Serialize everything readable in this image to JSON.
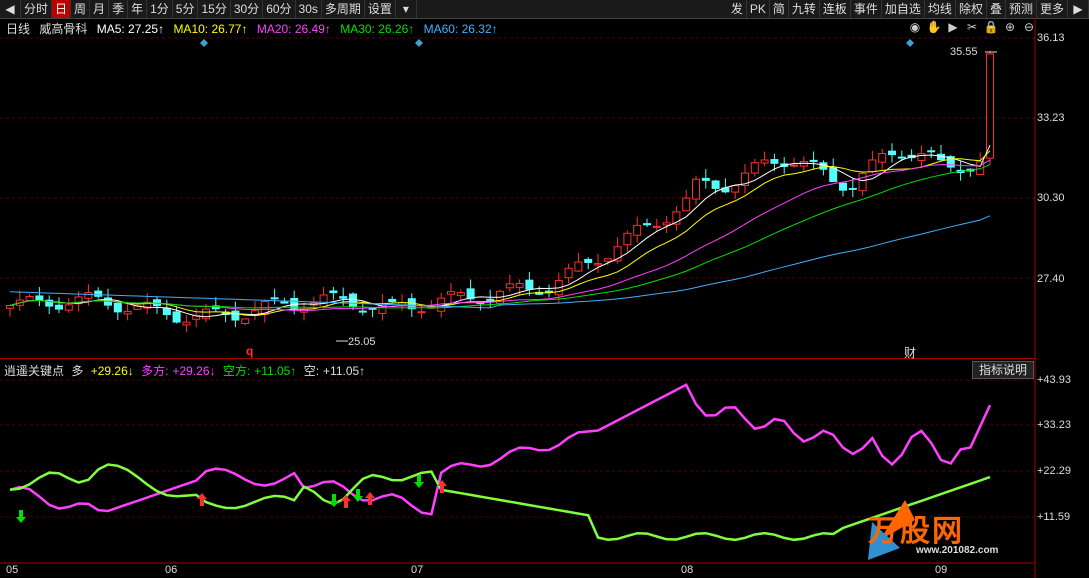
{
  "toolbar": {
    "left": [
      "分时",
      "日",
      "周",
      "月",
      "季",
      "年",
      "1分",
      "5分",
      "15分",
      "30分",
      "60分",
      "30s",
      "多周期",
      "设置"
    ],
    "active_index": 1,
    "right": [
      "发",
      "PK",
      "简",
      "九转",
      "连板",
      "事件",
      "加自选",
      "均线",
      "除权",
      "叠",
      "预测",
      "更多"
    ]
  },
  "legend": {
    "period": "日线",
    "name": "威高骨科",
    "ma5": "MA5: 27.25↑",
    "ma10": "MA10: 26.77↑",
    "ma20": "MA20: 26.49↑",
    "ma30": "MA30: 26.26↑",
    "ma60": "MA60: 26.32↑"
  },
  "colors": {
    "ma5": "#ffffff",
    "ma10": "#ffff00",
    "ma20": "#ff40ff",
    "ma30": "#00e000",
    "ma60": "#40b0ff",
    "up": "#ff3030",
    "down": "#54fcfc"
  },
  "price_axis": [
    "36.13",
    "33.23",
    "30.30",
    "27.40"
  ],
  "indicator_axis": [
    "+43.93",
    "+33.23",
    "+22.29",
    "+11.59"
  ],
  "dates": [
    "05",
    "06",
    "07",
    "08",
    "09"
  ],
  "annotations": {
    "high": "35.55",
    "low": "25.05",
    "mark_q": "q",
    "mark_cai": "财"
  },
  "indicator": {
    "name": "逍遥关键点",
    "duo": "多",
    "v1": "+29.26↓",
    "duofang_label": "多方:",
    "duofang": "+29.26↓",
    "kongfang_label": "空方:",
    "kongfang": "+11.05↑",
    "kong_label": "空:",
    "kong": "+11.05↑",
    "button": "指标说明"
  },
  "watermark": {
    "brand": "万股网",
    "url": "www.201082.com"
  }
}
